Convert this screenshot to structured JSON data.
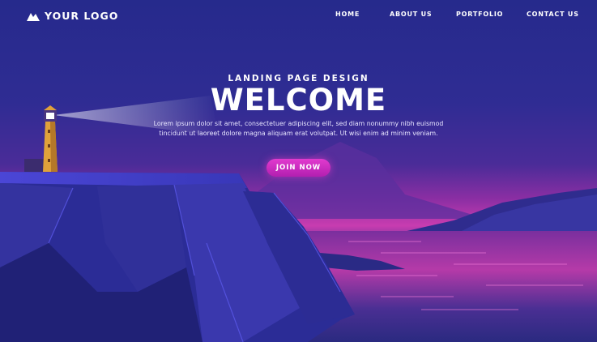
{
  "header": {
    "logo_text": "YOUR LOGO",
    "logo_icon": "mountain-icon",
    "nav": [
      {
        "label": "HOME"
      },
      {
        "label": "ABOUT US"
      },
      {
        "label": "PORTFOLIO"
      },
      {
        "label": "CONTACT US"
      }
    ]
  },
  "hero": {
    "subtitle": "LANDING PAGE DESIGN",
    "title": "WELCOME",
    "body_line1": "Lorem ipsum dolor sit amet, consectetuer adipiscing elit, sed diam nonummy nibh euismod",
    "body_line2": "tincidunt ut laoreet dolore magna aliquam erat volutpat. Ut wisi enim ad minim veniam.",
    "cta_label": "JOIN NOW"
  },
  "colors": {
    "sky_top": "#262a8c",
    "horizon_glow": "#c83cb0",
    "cliff": "#2e2f9e",
    "button": "#d22fc6",
    "lighthouse": "#e0a23a"
  }
}
